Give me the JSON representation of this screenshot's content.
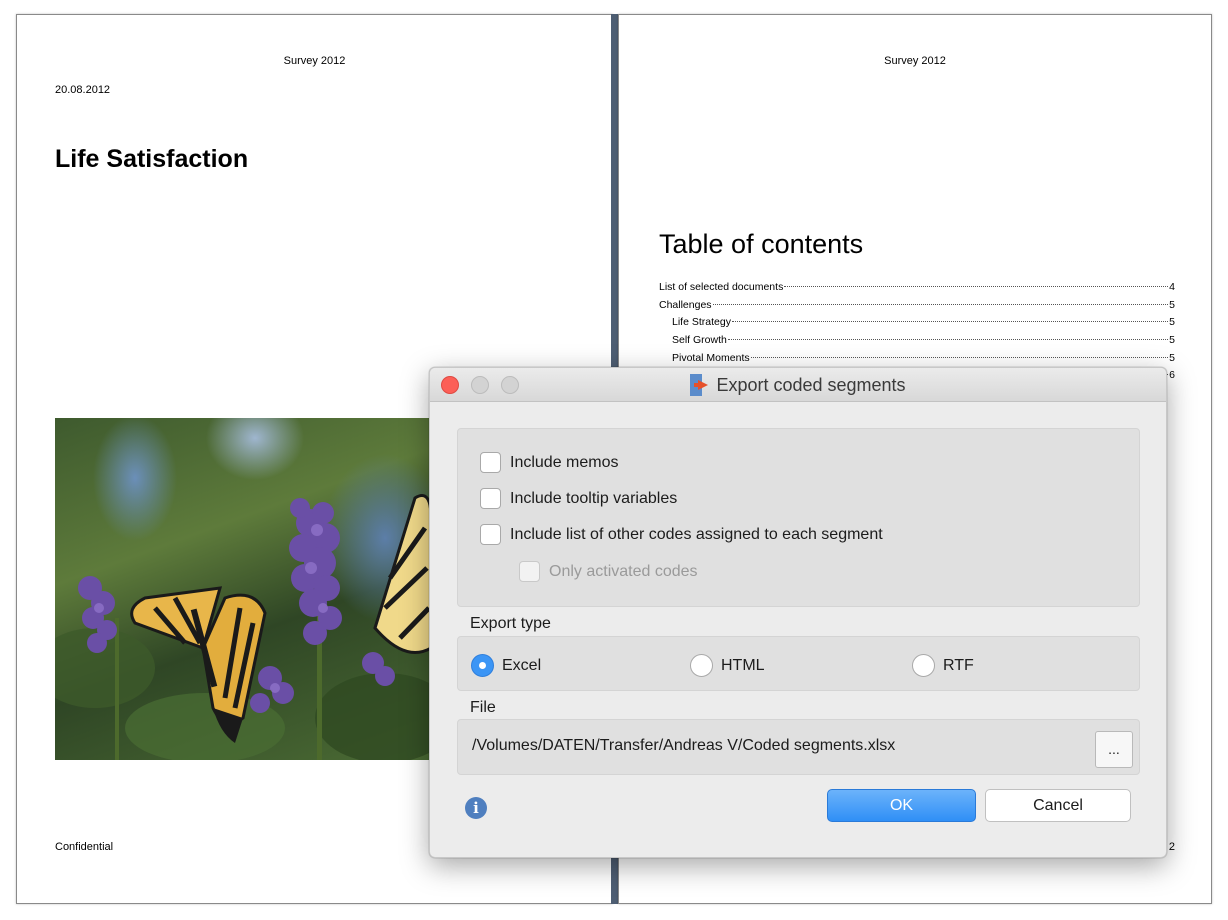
{
  "left_page": {
    "header": "Survey 2012",
    "date": "20.08.2012",
    "title": "Life Satisfaction",
    "footer": "Confidential"
  },
  "right_page": {
    "header": "Survey 2012",
    "toc_title": "Table of contents",
    "toc": [
      {
        "label": "List of selected documents",
        "page": "4",
        "indent": false
      },
      {
        "label": "Challenges",
        "page": "5",
        "indent": false
      },
      {
        "label": "Life Strategy",
        "page": "5",
        "indent": true
      },
      {
        "label": "Self Growth",
        "page": "5",
        "indent": true
      },
      {
        "label": "Pivotal Moments",
        "page": "5",
        "indent": true
      },
      {
        "label": "",
        "page": "6",
        "indent": false
      }
    ],
    "page_number": "2"
  },
  "dialog": {
    "title": "Export coded segments",
    "options": {
      "include_memos": "Include memos",
      "include_tooltip_variables": "Include tooltip variables",
      "include_other_codes": "Include list of other codes assigned to each segment",
      "only_activated_codes": "Only activated codes"
    },
    "export_type": {
      "label": "Export type",
      "selected": "Excel",
      "excel": "Excel",
      "html": "HTML",
      "rtf": "RTF"
    },
    "file": {
      "label": "File",
      "path": "/Volumes/DATEN/Transfer/Andreas V/Coded segments.xlsx",
      "browse": "..."
    },
    "info_glyph": "i",
    "ok": "OK",
    "cancel": "Cancel"
  },
  "colors": {
    "spine": "#4e5e73",
    "ok_button": "#2f8ff6",
    "close_button": "#fc5f57"
  }
}
